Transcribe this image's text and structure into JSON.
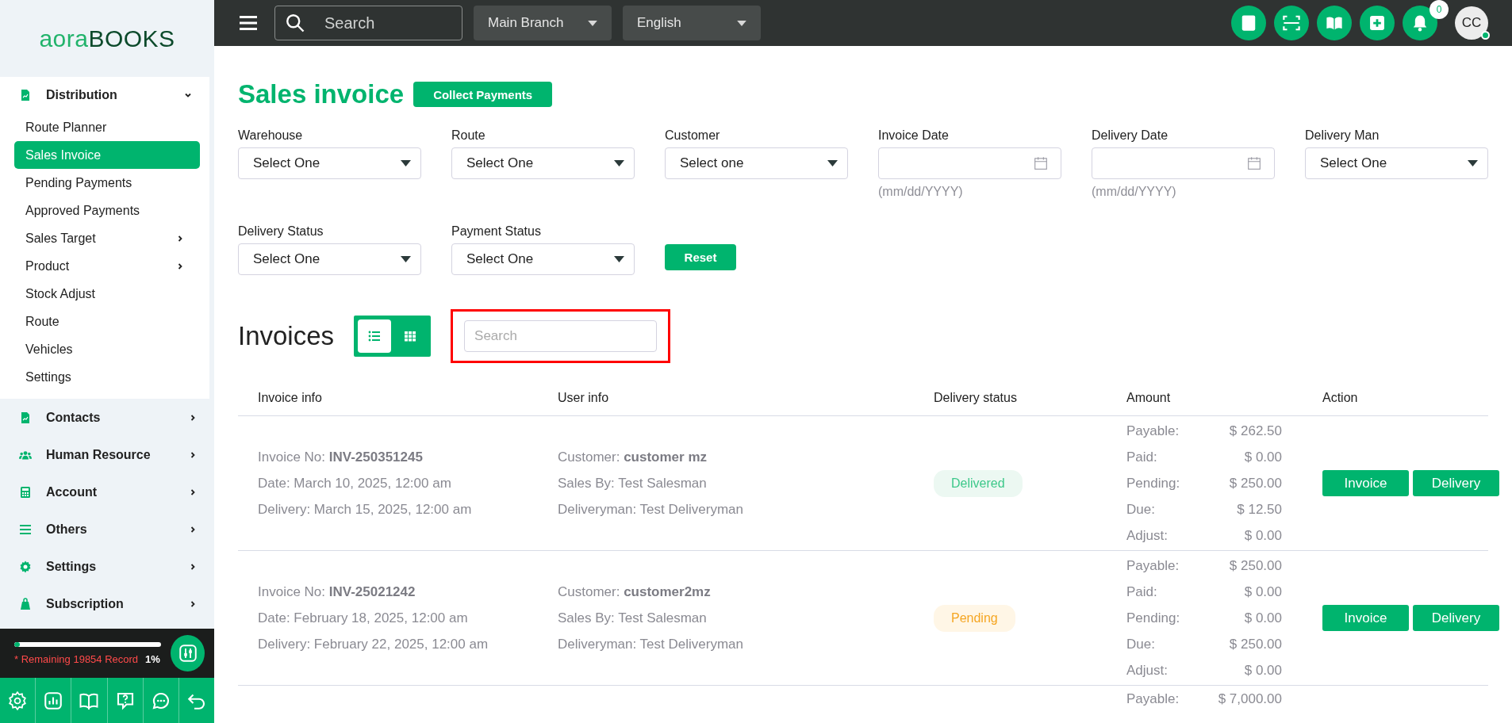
{
  "sidebar": {
    "logo": {
      "part_1": "aora",
      "part_2": "BOOKS"
    },
    "groups": [
      {
        "label": "Distribution",
        "expanded": true,
        "children": [
          {
            "label": "Route Planner",
            "selected": false,
            "expandable": false
          },
          {
            "label": "Sales Invoice",
            "selected": true,
            "expandable": false
          },
          {
            "label": "Pending Payments",
            "selected": false,
            "expandable": false
          },
          {
            "label": "Approved Payments",
            "selected": false,
            "expandable": false
          },
          {
            "label": "Sales Target",
            "selected": false,
            "expandable": true
          },
          {
            "label": "Product",
            "selected": false,
            "expandable": true
          },
          {
            "label": "Stock Adjust",
            "selected": false,
            "expandable": false
          },
          {
            "label": "Route",
            "selected": false,
            "expandable": false
          },
          {
            "label": "Vehicles",
            "selected": false,
            "expandable": false
          },
          {
            "label": "Settings",
            "selected": false,
            "expandable": false
          }
        ]
      },
      {
        "label": "Contacts",
        "expanded": false
      },
      {
        "label": "Human Resource",
        "expanded": false
      },
      {
        "label": "Account",
        "expanded": false
      },
      {
        "label": "Others",
        "expanded": false
      },
      {
        "label": "Settings",
        "expanded": false
      },
      {
        "label": "Subscription",
        "expanded": false
      }
    ],
    "usage": {
      "level": 0.04,
      "remaining": "* Remaining 19854 Record",
      "percent": "1%"
    }
  },
  "topbar": {
    "search": {
      "placeholder": "Search"
    },
    "branch": "Main Branch",
    "language": "English",
    "notification_count": "0",
    "avatar": "CC",
    "online": true
  },
  "page": {
    "title": "Sales invoice",
    "collect_button": "Collect Payments",
    "filters": [
      {
        "kind": "select",
        "label": "Warehouse",
        "value": "Select One"
      },
      {
        "kind": "select",
        "label": "Route",
        "value": "Select One"
      },
      {
        "kind": "select",
        "label": "Customer",
        "value": "Select one"
      },
      {
        "kind": "date",
        "label": "Invoice Date",
        "hint": "(mm/dd/YYYY)"
      },
      {
        "kind": "date",
        "label": "Delivery Date",
        "hint": "(mm/dd/YYYY)"
      },
      {
        "kind": "select",
        "label": "Delivery Man",
        "value": "Select One"
      },
      {
        "kind": "select",
        "label": "Delivery Status",
        "value": "Select One"
      },
      {
        "kind": "select",
        "label": "Payment Status",
        "value": "Select One"
      },
      {
        "kind": "reset",
        "label": "Reset"
      }
    ]
  },
  "invoices": {
    "title": "Invoices",
    "views": [
      {
        "kind": "list",
        "selected": true
      },
      {
        "kind": "grid",
        "selected": false
      }
    ],
    "search": {
      "placeholder": "Search",
      "highlighted": true
    },
    "table": {
      "columns": [
        "Invoice info",
        "User info",
        "Delivery status",
        "Amount",
        "Action"
      ],
      "rows": [
        {
          "invoice_info": [
            "Invoice No: **INV-250351245**",
            "Date: March 10, 2025, 12:00 am",
            "Delivery: March 15, 2025, 12:00 am"
          ],
          "user_info": [
            "Customer: **customer mz**",
            "Sales By: Test Salesman",
            "Deliveryman: Test Deliveryman"
          ],
          "status": {
            "label": "Delivered",
            "kind": "delivered"
          },
          "amounts": [
            {
              "label": "Payable:",
              "value": "$ 262.50"
            },
            {
              "label": "Paid:",
              "value": "$ 0.00"
            },
            {
              "label": "Pending:",
              "value": "$ 250.00"
            },
            {
              "label": "Due:",
              "value": "$ 12.50"
            },
            {
              "label": "Adjust:",
              "value": "$ 0.00"
            }
          ],
          "actions": [
            "Invoice",
            "Delivery"
          ]
        },
        {
          "invoice_info": [
            "Invoice No: **INV-25021242**",
            "Date: February 18, 2025, 12:00 am",
            "Delivery: February 22, 2025, 12:00 am"
          ],
          "user_info": [
            "Customer: **customer2mz**",
            "Sales By: Test Salesman",
            "Deliveryman: Test Deliveryman"
          ],
          "status": {
            "label": "Pending",
            "kind": "pending"
          },
          "amounts": [
            {
              "label": "Payable:",
              "value": "$ 250.00"
            },
            {
              "label": "Paid:",
              "value": "$ 0.00"
            },
            {
              "label": "Pending:",
              "value": "$ 0.00"
            },
            {
              "label": "Due:",
              "value": "$ 250.00"
            },
            {
              "label": "Adjust:",
              "value": "$ 0.00"
            }
          ],
          "actions": [
            "Invoice",
            "Delivery"
          ]
        },
        {
          "amounts": [
            {
              "label": "Payable:",
              "value": "$ 7,000.00"
            }
          ]
        }
      ]
    }
  }
}
